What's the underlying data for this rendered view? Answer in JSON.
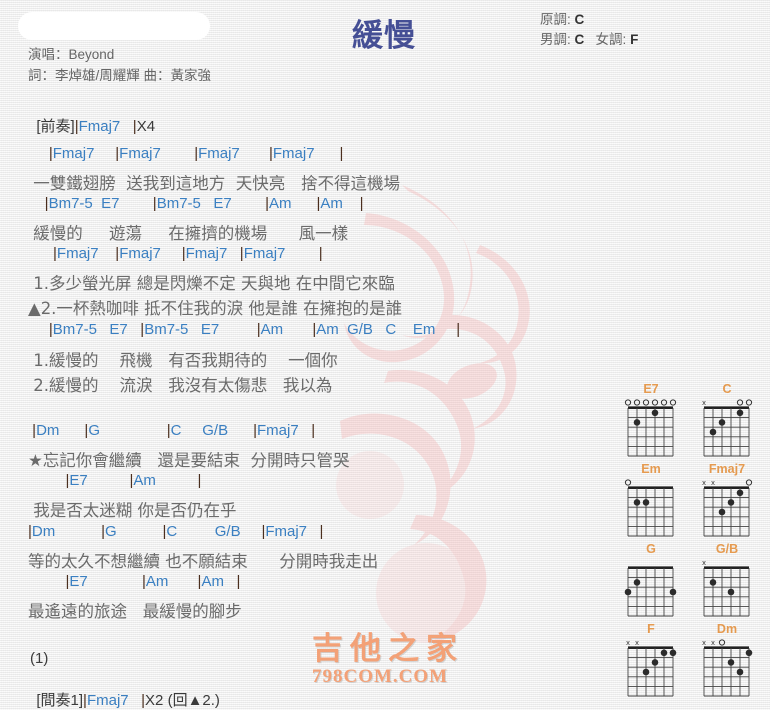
{
  "header": {
    "title": "緩慢",
    "original_key_label": "原調:",
    "original_key": "C",
    "male_key_label": "男調:",
    "male_key": "C",
    "female_key_label": "女調:",
    "female_key": "F",
    "singer_line": "演唱：Beyond",
    "writer_line": "詞：李焯雄/周耀輝   曲：黃家強"
  },
  "watermark": {
    "brand_cn": "吉他之家",
    "brand_url": "798COM.COM"
  },
  "intro": {
    "tag": "[前奏]",
    "bar": "|",
    "chord": "Fmaj7",
    "repeat_bar": "|",
    "repeat": "X4"
  },
  "sections": [
    {
      "chords": "     |Fmaj7     |Fmaj7        |Fmaj7       |Fmaj7      |",
      "lyric": " 一雙鐵翅膀  送我到這地方  天快亮   捨不得這機場"
    },
    {
      "chords": "    |Bm7-5  E7        |Bm7-5   E7        |Am      |Am    |",
      "lyric": " 緩慢的     遊蕩     在擁擠的機場      風一樣"
    },
    {
      "chords": "      |Fmaj7    |Fmaj7     |Fmaj7   |Fmaj7        |",
      "lyric": " 1.多少螢光屏 總是閃爍不定 天與地 在中間它來臨"
    },
    {
      "chords": "",
      "lyric": "▲2.一杯熱咖啡 抵不住我的淚 他是誰 在擁抱的是誰"
    },
    {
      "chords": "     |Bm7-5   E7   |Bm7-5   E7         |Am       |Am  G/B   C    Em     |",
      "lyric": " 1.緩慢的    飛機   有否我期待的    一個你"
    },
    {
      "chords": "",
      "lyric": " 2.緩慢的    流淚   我沒有太傷悲   我以為"
    },
    {
      "chords": " |Dm      |G                |C     G/B      |Fmaj7   |",
      "lyric": "★忘記你會繼續   還是要結束  分開時只管哭"
    },
    {
      "chords": "         |E7          |Am          |",
      "lyric": " 我是否太迷糊 你是否仍在乎"
    },
    {
      "chords": "|Dm           |G           |C         G/B     |Fmaj7   |",
      "lyric": "等的太久不想繼續 也不願結束      分開時我走出"
    },
    {
      "chords": "         |E7             |Am       |Am   |",
      "lyric": "最遙遠的旅途   最緩慢的腳步"
    }
  ],
  "footer": {
    "counter": "(1)",
    "tag": "[間奏1]",
    "bar": "|",
    "chord": "Fmaj7",
    "repeat_bar": "|",
    "repeat": "X2",
    "note": "(回▲2.)"
  },
  "chord_diagrams": [
    {
      "name": "E7",
      "markers": [
        "o",
        "o",
        "o",
        "o",
        "o",
        "o"
      ],
      "dots": [
        {
          "string": 5,
          "fret": 2
        },
        {
          "string": 3,
          "fret": 1
        }
      ]
    },
    {
      "name": "C",
      "markers": [
        "x",
        "",
        "",
        "",
        "o",
        "o"
      ],
      "dots": [
        {
          "string": 5,
          "fret": 3
        },
        {
          "string": 4,
          "fret": 2
        },
        {
          "string": 2,
          "fret": 1
        }
      ]
    },
    {
      "name": "Em",
      "markers": [
        "o",
        "",
        "",
        "",
        "",
        ""
      ],
      "dots": [
        {
          "string": 5,
          "fret": 2
        },
        {
          "string": 4,
          "fret": 2
        }
      ]
    },
    {
      "name": "Fmaj7",
      "markers": [
        "x",
        "x",
        "",
        "",
        "",
        "o"
      ],
      "dots": [
        {
          "string": 4,
          "fret": 3
        },
        {
          "string": 3,
          "fret": 2
        },
        {
          "string": 2,
          "fret": 1
        }
      ]
    },
    {
      "name": "G",
      "markers": [
        "",
        "",
        "",
        "",
        "",
        ""
      ],
      "dots": [
        {
          "string": 6,
          "fret": 3
        },
        {
          "string": 5,
          "fret": 2
        },
        {
          "string": 1,
          "fret": 3
        }
      ]
    },
    {
      "name": "G/B",
      "markers": [
        "x",
        "",
        "",
        "",
        "",
        ""
      ],
      "dots": [
        {
          "string": 5,
          "fret": 2
        },
        {
          "string": 3,
          "fret": 3
        }
      ]
    },
    {
      "name": "F",
      "markers": [
        "x",
        "x",
        "",
        "",
        "",
        ""
      ],
      "dots": [
        {
          "string": 4,
          "fret": 3
        },
        {
          "string": 3,
          "fret": 2
        },
        {
          "string": 2,
          "fret": 1
        },
        {
          "string": 1,
          "fret": 1
        }
      ]
    },
    {
      "name": "Dm",
      "markers": [
        "x",
        "x",
        "o",
        "",
        "",
        ""
      ],
      "dots": [
        {
          "string": 3,
          "fret": 2
        },
        {
          "string": 2,
          "fret": 3
        },
        {
          "string": 1,
          "fret": 1
        }
      ]
    }
  ],
  "colors": {
    "title": "#454f95",
    "chord": "#3a7fc1",
    "bar": "#4a2e1e",
    "lyric": "#6b6b6b",
    "diagram_name": "#e59a4f",
    "watermark": "#f3a177"
  }
}
